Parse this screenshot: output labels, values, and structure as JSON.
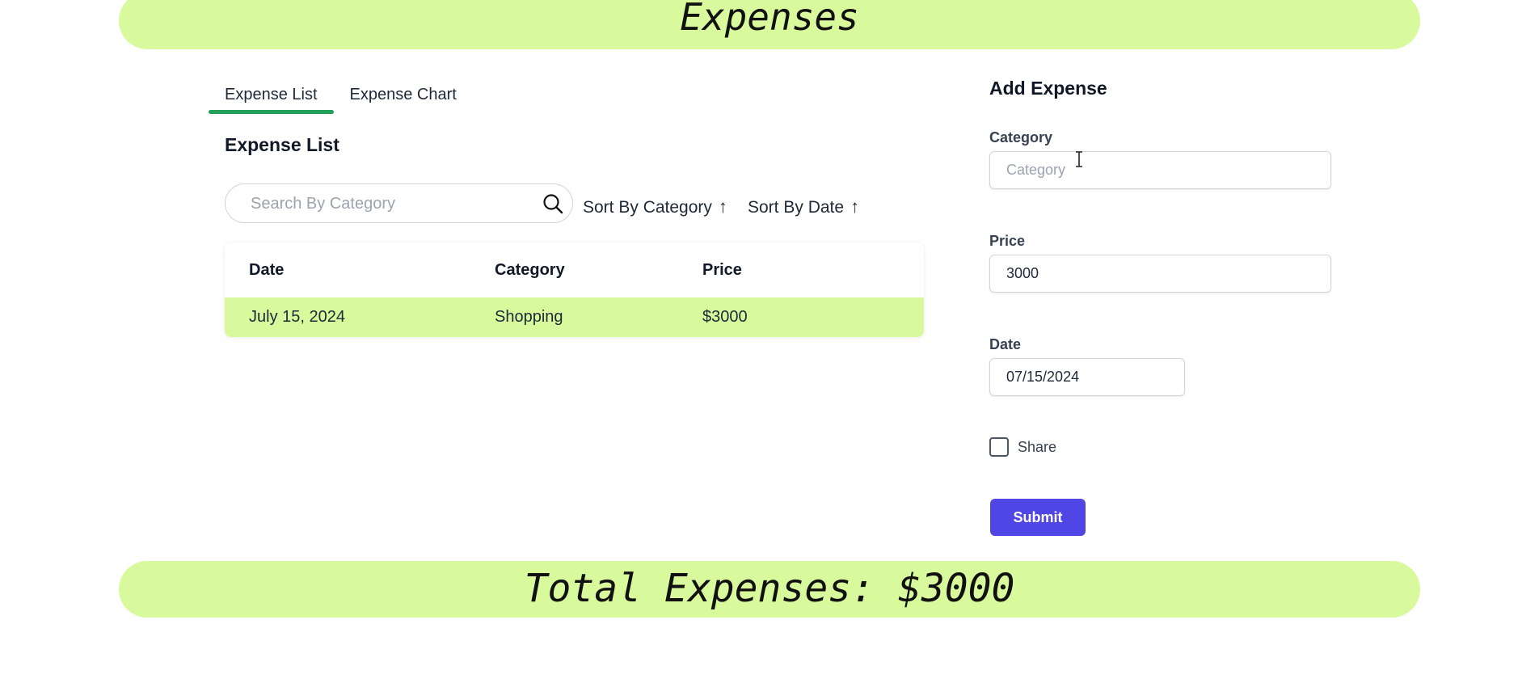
{
  "header": {
    "title": "Expenses"
  },
  "tabs": [
    {
      "label": "Expense List",
      "active": true
    },
    {
      "label": "Expense Chart",
      "active": false
    }
  ],
  "list": {
    "title": "Expense List",
    "search_placeholder": "Search By Category",
    "sort_category_label": "Sort By Category",
    "sort_date_label": "Sort By Date",
    "sort_arrow": "↑",
    "columns": [
      "Date",
      "Category",
      "Price"
    ],
    "rows": [
      {
        "date": "July 15, 2024",
        "category": "Shopping",
        "price": "$3000"
      }
    ]
  },
  "form": {
    "title": "Add Expense",
    "category_label": "Category",
    "category_placeholder": "Category",
    "category_value": "",
    "price_label": "Price",
    "price_value": "3000",
    "date_label": "Date",
    "date_value": "07/15/2024",
    "share_label": "Share",
    "share_checked": false,
    "submit_label": "Submit"
  },
  "footer": {
    "total_text": "Total Expenses: $3000"
  },
  "colors": {
    "banner": "#d9f99d",
    "tab_underline": "#22a05a",
    "submit": "#4f46e5"
  },
  "icons": {
    "search": "search-icon",
    "text_cursor": "text-cursor-icon"
  }
}
